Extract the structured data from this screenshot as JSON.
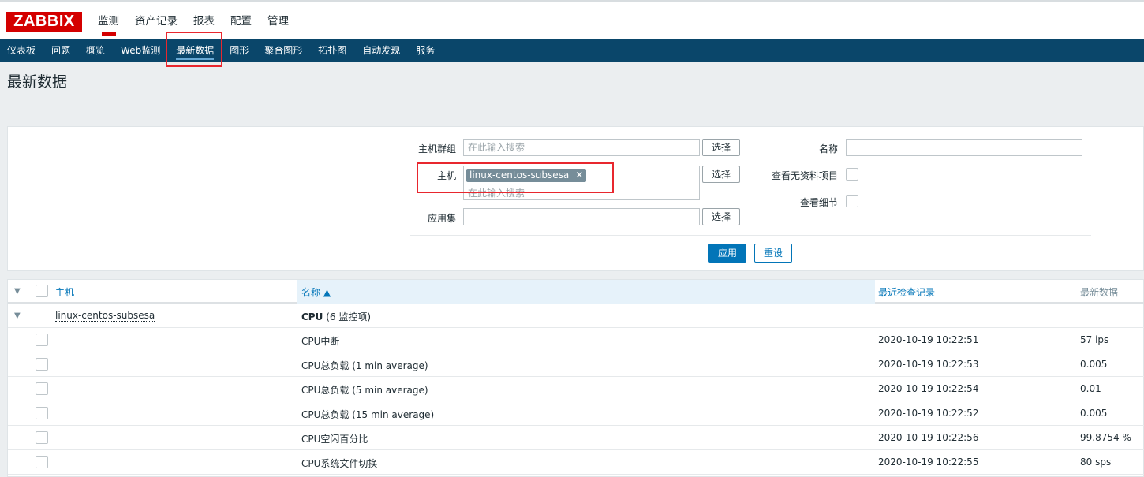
{
  "app": {
    "logo": "ZABBIX"
  },
  "main_menu": [
    {
      "label": "监测",
      "active": true
    },
    {
      "label": "资产记录"
    },
    {
      "label": "报表"
    },
    {
      "label": "配置"
    },
    {
      "label": "管理"
    }
  ],
  "sub_menu": [
    {
      "label": "仪表板"
    },
    {
      "label": "问题"
    },
    {
      "label": "概览"
    },
    {
      "label": "Web监测"
    },
    {
      "label": "最新数据",
      "active": true
    },
    {
      "label": "图形"
    },
    {
      "label": "聚合图形"
    },
    {
      "label": "拓扑图"
    },
    {
      "label": "自动发现"
    },
    {
      "label": "服务"
    }
  ],
  "page": {
    "title": "最新数据"
  },
  "filter": {
    "host_group_label": "主机群组",
    "host_group_placeholder": "在此输入搜索",
    "host_label": "主机",
    "host_tag": "linux-centos-subsesa",
    "host_placeholder": "在此输入搜索",
    "application_label": "应用集",
    "select_label": "选择",
    "name_label": "名称",
    "show_without_data_label": "查看无资料项目",
    "show_details_label": "查看细节",
    "apply_label": "应用",
    "reset_label": "重设"
  },
  "table": {
    "columns": {
      "host": "主机",
      "name": "名称 ▲",
      "last_check": "最近检查记录",
      "last_value": "最新数据"
    },
    "group": {
      "host": "linux-centos-subsesa",
      "app": "CPU",
      "count": "(6 监控项)"
    },
    "rows": [
      {
        "name": "CPU中断",
        "last_check": "2020-10-19 10:22:51",
        "last_value": "57 ips"
      },
      {
        "name": "CPU总负载 (1 min average)",
        "last_check": "2020-10-19 10:22:53",
        "last_value": "0.005"
      },
      {
        "name": "CPU总负载 (5 min average)",
        "last_check": "2020-10-19 10:22:54",
        "last_value": "0.01"
      },
      {
        "name": "CPU总负载 (15 min average)",
        "last_check": "2020-10-19 10:22:52",
        "last_value": "0.005"
      },
      {
        "name": "CPU空闲百分比",
        "last_check": "2020-10-19 10:22:56",
        "last_value": "99.8754 %"
      },
      {
        "name": "CPU系统文件切换",
        "last_check": "2020-10-19 10:22:55",
        "last_value": "80 sps"
      }
    ]
  },
  "colors": {
    "brand": "#d40000",
    "submenu_bg": "#0a466a",
    "link": "#0275b8",
    "highlight": "#e8272e"
  }
}
